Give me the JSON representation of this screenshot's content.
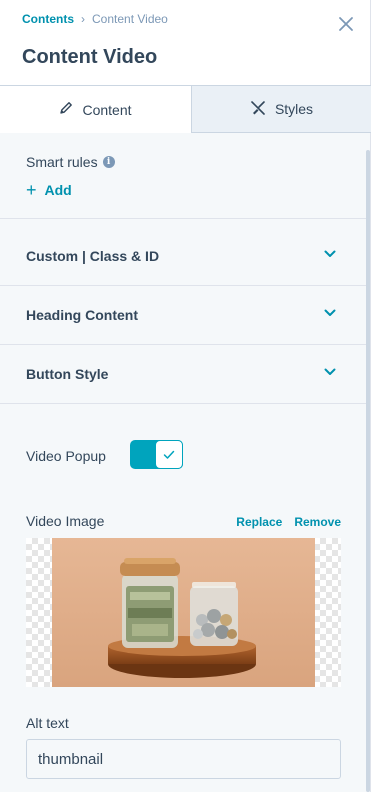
{
  "header": {
    "breadcrumb_root": "Contents",
    "breadcrumb_current": "Content Video",
    "title": "Content Video"
  },
  "tabs": [
    {
      "label": "Content",
      "icon": "pencil-icon",
      "active": true
    },
    {
      "label": "Styles",
      "icon": "brush-icon",
      "active": false
    }
  ],
  "smart_rules": {
    "label": "Smart rules",
    "add_label": "Add"
  },
  "sections": [
    {
      "label": "Custom | Class & ID"
    },
    {
      "label": "Heading Content"
    },
    {
      "label": "Button Style"
    }
  ],
  "video_popup": {
    "label": "Video Popup",
    "enabled": true
  },
  "video_image": {
    "label": "Video Image",
    "replace_label": "Replace",
    "remove_label": "Remove"
  },
  "alt_text": {
    "label": "Alt text",
    "value": "thumbnail"
  },
  "colors": {
    "accent": "#0091ae",
    "toggle_on": "#00a4bd",
    "text": "#33475b",
    "panel_bg": "#f5f8fa"
  }
}
